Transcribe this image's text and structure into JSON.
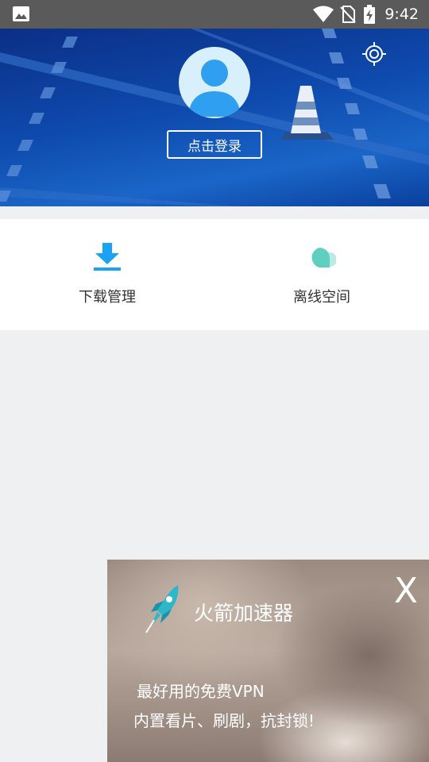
{
  "status_bar": {
    "time": "9:42",
    "icons": [
      "gallery-icon",
      "wifi-icon",
      "no-sim-icon",
      "battery-charging-icon"
    ]
  },
  "header": {
    "login_label": "点击登录",
    "settings_icon": "settings-icon",
    "avatar_icon": "user-avatar-icon",
    "background_color": "#0e4aad"
  },
  "functions": [
    {
      "label": "下载管理",
      "icon": "download-icon",
      "color": "#1aa3f0"
    },
    {
      "label": "离线空间",
      "icon": "cloud-icon",
      "color": "#5fd0c0"
    }
  ],
  "ad": {
    "title": "火箭加速器",
    "line1": "最好用的免费VPN",
    "line2": "内置看片、刷剧，抗封锁!",
    "close_label": "X",
    "logo_icon": "rocket-icon"
  },
  "colors": {
    "page_background": "#eff0f2",
    "status_bar": "#5a5a5a"
  }
}
